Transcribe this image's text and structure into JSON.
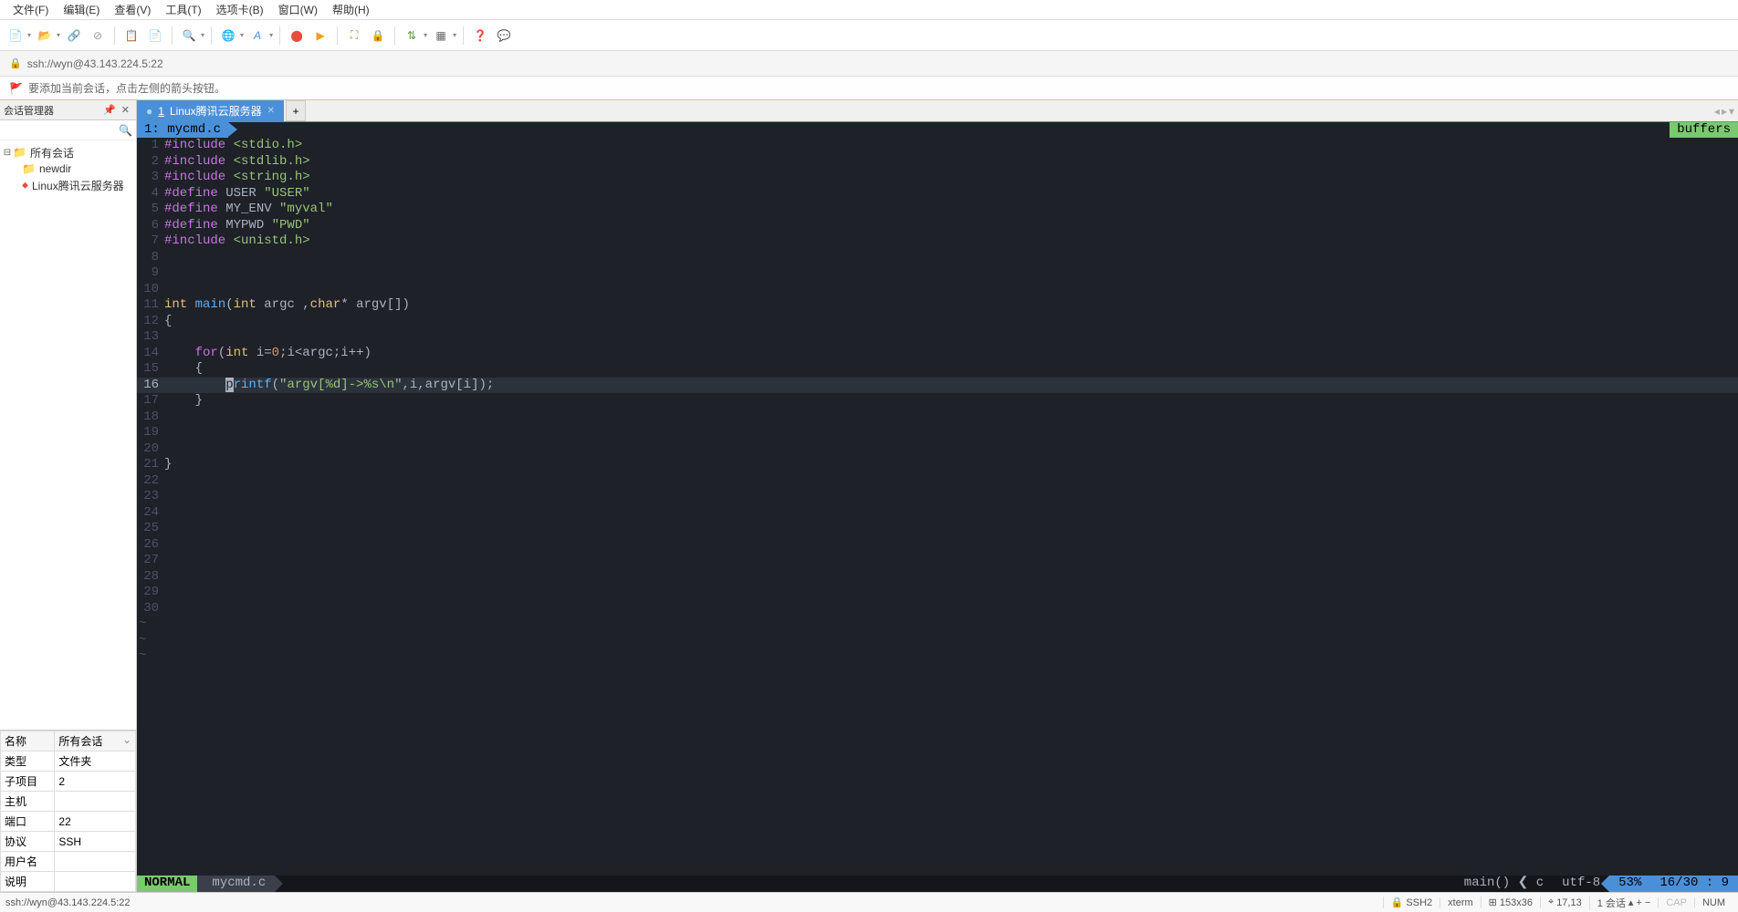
{
  "menu": {
    "file": "文件(F)",
    "edit": "编辑(E)",
    "view": "查看(V)",
    "tools": "工具(T)",
    "tabs": "选项卡(B)",
    "window": "窗口(W)",
    "help": "帮助(H)"
  },
  "address": {
    "url": "ssh://wyn@43.143.224.5:22"
  },
  "hint": {
    "text": "要添加当前会话，点击左侧的箭头按钮。"
  },
  "sidebar": {
    "title": "会话管理器",
    "tree": {
      "root": "所有会话",
      "items": [
        "newdir",
        "Linux腾讯云服务器"
      ]
    }
  },
  "props": {
    "headers": [
      "名称",
      "所有会话"
    ],
    "rows": [
      [
        "类型",
        "文件夹"
      ],
      [
        "子项目",
        "2"
      ],
      [
        "主机",
        ""
      ],
      [
        "端口",
        "22"
      ],
      [
        "协议",
        "SSH"
      ],
      [
        "用户名",
        ""
      ],
      [
        "说明",
        ""
      ]
    ]
  },
  "tabs": {
    "active": {
      "index": "1",
      "label": "Linux腾讯云服务器"
    }
  },
  "editor": {
    "buffer_tab": "1: mycmd.c",
    "buffers_label": "buffers",
    "lines": [
      {
        "n": 1,
        "html": "<span class='pp'>#include</span> <span class='inc'>&lt;stdio.h&gt;</span>"
      },
      {
        "n": 2,
        "html": "<span class='pp'>#include</span> <span class='inc'>&lt;stdlib.h&gt;</span>"
      },
      {
        "n": 3,
        "html": "<span class='pp'>#include</span> <span class='inc'>&lt;string.h&gt;</span>"
      },
      {
        "n": 4,
        "html": "<span class='pp'>#define</span> USER <span class='str'>\"USER\"</span>"
      },
      {
        "n": 5,
        "html": "<span class='pp'>#define</span> MY_ENV <span class='str'>\"myval\"</span>"
      },
      {
        "n": 6,
        "html": "<span class='pp'>#define</span> MYPWD <span class='str'>\"PWD\"</span>"
      },
      {
        "n": 7,
        "html": "<span class='pp'>#include</span> <span class='inc'>&lt;unistd.h&gt;</span>"
      },
      {
        "n": 8,
        "html": ""
      },
      {
        "n": 9,
        "html": ""
      },
      {
        "n": 10,
        "html": ""
      },
      {
        "n": 11,
        "html": "<span class='type'>int</span> <span class='fn'>main</span>(<span class='type'>int</span> argc ,<span class='type'>char</span>* argv[])"
      },
      {
        "n": 12,
        "html": "{"
      },
      {
        "n": 13,
        "html": ""
      },
      {
        "n": 14,
        "html": "    <span class='kw'>for</span>(<span class='type'>int</span> i=<span class='num'>0</span>;i&lt;argc;i++)"
      },
      {
        "n": 15,
        "html": "    {"
      },
      {
        "n": 16,
        "html": "        <span class='cursor'>p</span><span class='fn'>rintf</span>(<span class='str'>\"argv[%d]-&gt;%s\\n\"</span>,i,argv[i]);",
        "active": true
      },
      {
        "n": 17,
        "html": "    }"
      },
      {
        "n": 18,
        "html": ""
      },
      {
        "n": 19,
        "html": ""
      },
      {
        "n": 20,
        "html": ""
      },
      {
        "n": 21,
        "html": "}"
      },
      {
        "n": 22,
        "html": ""
      },
      {
        "n": 23,
        "html": ""
      },
      {
        "n": 24,
        "html": ""
      },
      {
        "n": 25,
        "html": ""
      },
      {
        "n": 26,
        "html": ""
      },
      {
        "n": 27,
        "html": ""
      },
      {
        "n": 28,
        "html": ""
      },
      {
        "n": 29,
        "html": ""
      },
      {
        "n": 30,
        "html": ""
      }
    ],
    "tilde_count": 3,
    "status": {
      "mode": "NORMAL",
      "file": "mycmd.c",
      "func": "main() ❮ c",
      "encoding": "utf-8",
      "percent": "53%",
      "pos": "16/30 :  9"
    }
  },
  "statusbar": {
    "left": "ssh://wyn@43.143.224.5:22",
    "ssh": "SSH2",
    "term": "xterm",
    "size": "153x36",
    "cursor": "17,13",
    "sessions": "1 会话",
    "cap": "CAP",
    "num": "NUM"
  }
}
